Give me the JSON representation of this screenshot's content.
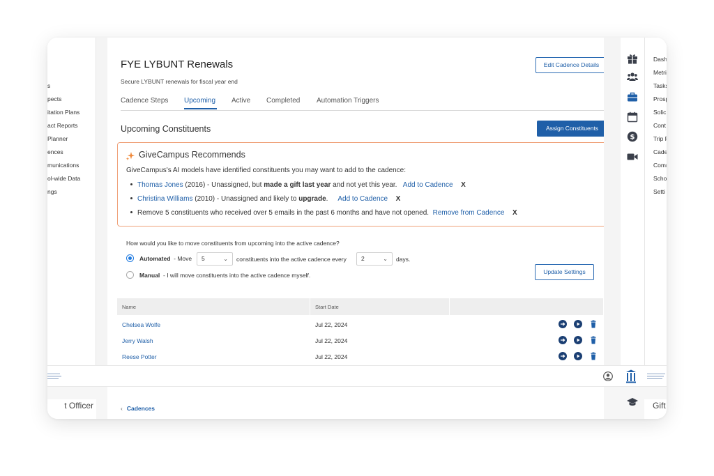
{
  "left_sidebar": {
    "items": [
      "s",
      "pects",
      "itation Plans",
      "act Reports",
      "Planner",
      "ences",
      "munications",
      "ol-wide Data",
      "ngs"
    ]
  },
  "right_panel": {
    "items": [
      "Dash",
      "Metri",
      "Tasks",
      "Prosp",
      "Solic",
      "Cont",
      "Trip F",
      "Cade",
      "Comr",
      "Scho",
      "Setti"
    ]
  },
  "header": {
    "title": "FYE LYBUNT Renewals",
    "subtitle": "Secure LYBUNT renewals for fiscal year end",
    "edit_button": "Edit Cadence Details"
  },
  "tabs": [
    "Cadence Steps",
    "Upcoming",
    "Active",
    "Completed",
    "Automation Triggers"
  ],
  "active_tab": "Upcoming",
  "section": {
    "title": "Upcoming Constituents",
    "assign_button": "Assign Constituents"
  },
  "recommendations": {
    "title": "GiveCampus Recommends",
    "intro": "GiveCampus's AI models have identified constituents you may want to add to the cadence:",
    "items": [
      {
        "name": "Thomas Jones",
        "year": "(2016)",
        "text_a": " -  Unassigned, but ",
        "bold": "made a gift last year",
        "text_b": " and not yet this year.",
        "action": "Add to Cadence",
        "dismiss": "X"
      },
      {
        "name": "Christina Williams",
        "year": "(2010)",
        "text_a": " - Unassigned and likely to ",
        "bold": "upgrade",
        "text_b": ".",
        "action": "Add to Cadence",
        "dismiss": "X"
      },
      {
        "text": "Remove 5 constituents who received over 5 emails in the past 6 months and have not opened.",
        "action": "Remove from Cadence",
        "dismiss": "X"
      }
    ]
  },
  "settings": {
    "question": "How would you like to move constituents from upcoming into the active cadence?",
    "automated_label": "Automated",
    "automated_text_a": "- Move",
    "count_value": "5",
    "automated_text_b": "constituents into the active cadence every",
    "days_value": "2",
    "automated_text_c": "days.",
    "manual_label": "Manual",
    "manual_text": "- I will move constituents into the active cadence myself.",
    "selected": "Automated",
    "update_button": "Update Settings"
  },
  "table": {
    "columns": [
      "Name",
      "Start Date"
    ],
    "rows": [
      {
        "name": "Chelsea Wolfe",
        "start": "Jul 22, 2024"
      },
      {
        "name": "Jerry Walsh",
        "start": "Jul 22, 2024"
      },
      {
        "name": "Reese Potter",
        "start": "Jul 22, 2024"
      }
    ]
  },
  "lower": {
    "left_title": "t Officer",
    "breadcrumb_chevron": "‹",
    "breadcrumb": "Cadences",
    "right_title": "Gift"
  },
  "colors": {
    "primary": "#1f5fa8",
    "recommend_border": "#f0a27a",
    "spark": "#f08a3c"
  }
}
